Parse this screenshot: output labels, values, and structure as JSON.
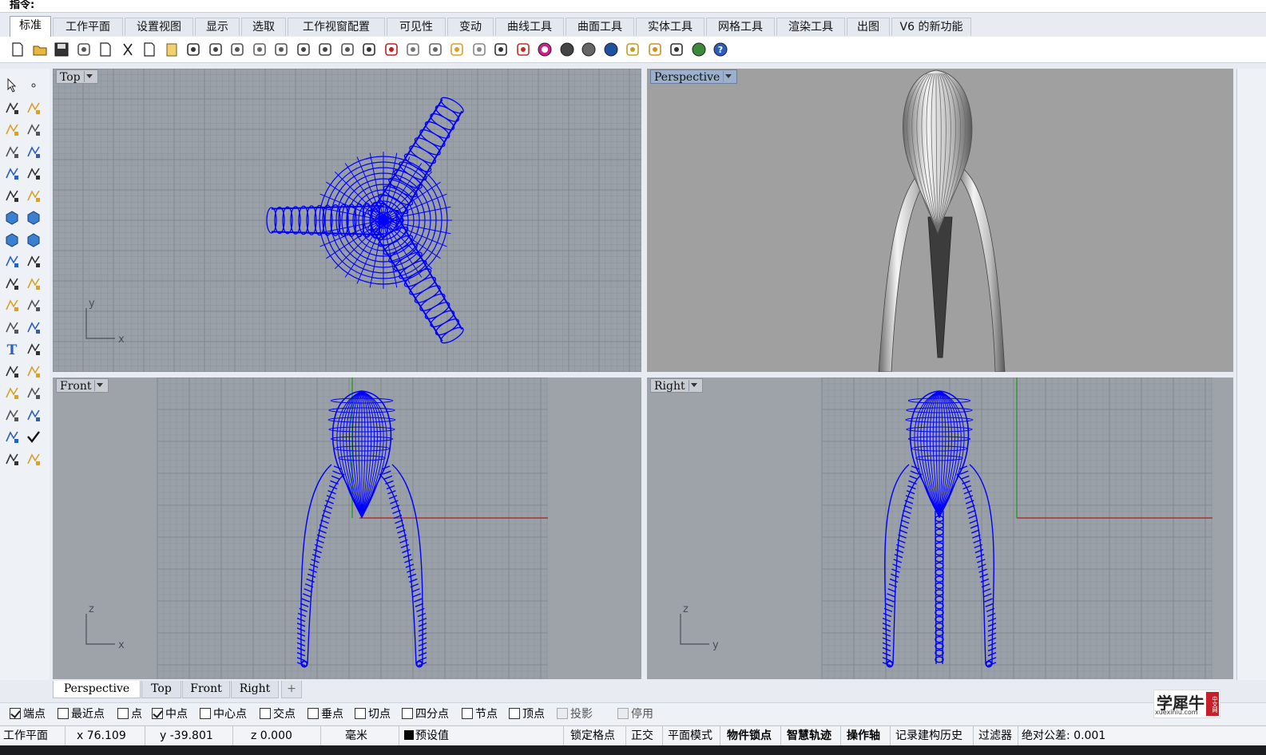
{
  "command": {
    "prompt": "指令:"
  },
  "ribbon": {
    "tabs": [
      "标准",
      "工作平面",
      "设置视图",
      "显示",
      "选取",
      "工作视窗配置",
      "可见性",
      "变动",
      "曲线工具",
      "曲面工具",
      "实体工具",
      "网格工具",
      "渲染工具",
      "出图",
      "V6 的新功能"
    ],
    "active": 0
  },
  "toolbar": {
    "icons": [
      "new-file-icon",
      "open-folder-icon",
      "save-icon",
      "print-icon",
      "import-icon",
      "cut-icon",
      "copy-icon",
      "paste-icon",
      "undo-icon",
      "pan-hand-icon",
      "rotate-view-icon",
      "zoom-dynamic-icon",
      "zoom-window-icon",
      "zoom-extents-icon",
      "zoom-selected-icon",
      "rotate-icon",
      "four-views-icon",
      "car-icon",
      "properties-icon",
      "circle-icon",
      "select-points-icon",
      "light-icon",
      "lock-icon",
      "layer-icon",
      "color-wheel-icon",
      "render-sphere-icon",
      "shaded-sphere-icon",
      "material-sphere-icon",
      "render-icon",
      "options-gear-icon",
      "snap-icon",
      "earth-icon",
      "help-icon"
    ]
  },
  "viewports": {
    "top": {
      "label": "Top",
      "axis_a": "x",
      "axis_b": "y"
    },
    "perspective": {
      "label": "Perspective"
    },
    "front": {
      "label": "Front",
      "axis_a": "x",
      "axis_b": "z"
    },
    "right": {
      "label": "Right",
      "axis_a": "y",
      "axis_b": "z"
    }
  },
  "viewtabs": {
    "tabs": [
      "Perspective",
      "Top",
      "Front",
      "Right"
    ],
    "add": "+",
    "active": 0
  },
  "osnap": [
    {
      "label": "端点",
      "checked": true,
      "disabled": false
    },
    {
      "label": "最近点",
      "checked": false,
      "disabled": false
    },
    {
      "label": "点",
      "checked": false,
      "disabled": false
    },
    {
      "label": "中点",
      "checked": true,
      "disabled": false
    },
    {
      "label": "中心点",
      "checked": false,
      "disabled": false
    },
    {
      "label": "交点",
      "checked": false,
      "disabled": false
    },
    {
      "label": "垂点",
      "checked": false,
      "disabled": false
    },
    {
      "label": "切点",
      "checked": false,
      "disabled": false
    },
    {
      "label": "四分点",
      "checked": false,
      "disabled": false
    },
    {
      "label": "节点",
      "checked": false,
      "disabled": false
    },
    {
      "label": "顶点",
      "checked": false,
      "disabled": false
    },
    {
      "label": "投影",
      "checked": false,
      "disabled": true
    },
    {
      "label": "停用",
      "checked": false,
      "disabled": true
    }
  ],
  "status": {
    "cplane": "工作平面",
    "x": "x 76.109",
    "y": "y -39.801",
    "z": "z 0.000",
    "unit": "毫米",
    "layer": "预设值",
    "grid_snap": "锁定格点",
    "ortho": "正交",
    "planar": "平面模式",
    "osnap": "物件锁点",
    "smarttrack": "智慧轨迹",
    "gumball": "操作轴",
    "history": "记录建构历史",
    "filter": "过滤器",
    "tolerance": "绝对公差: 0.001"
  },
  "logo": {
    "text": "学犀牛",
    "url": "xuexiniu.com",
    "badge": "中文网"
  },
  "colors": {
    "wire": "#0000ff",
    "viewport_bg": "#9ea3aa",
    "grid": "#8a9099",
    "x_axis": "#b03030",
    "y_axis": "#2a9a2a"
  }
}
